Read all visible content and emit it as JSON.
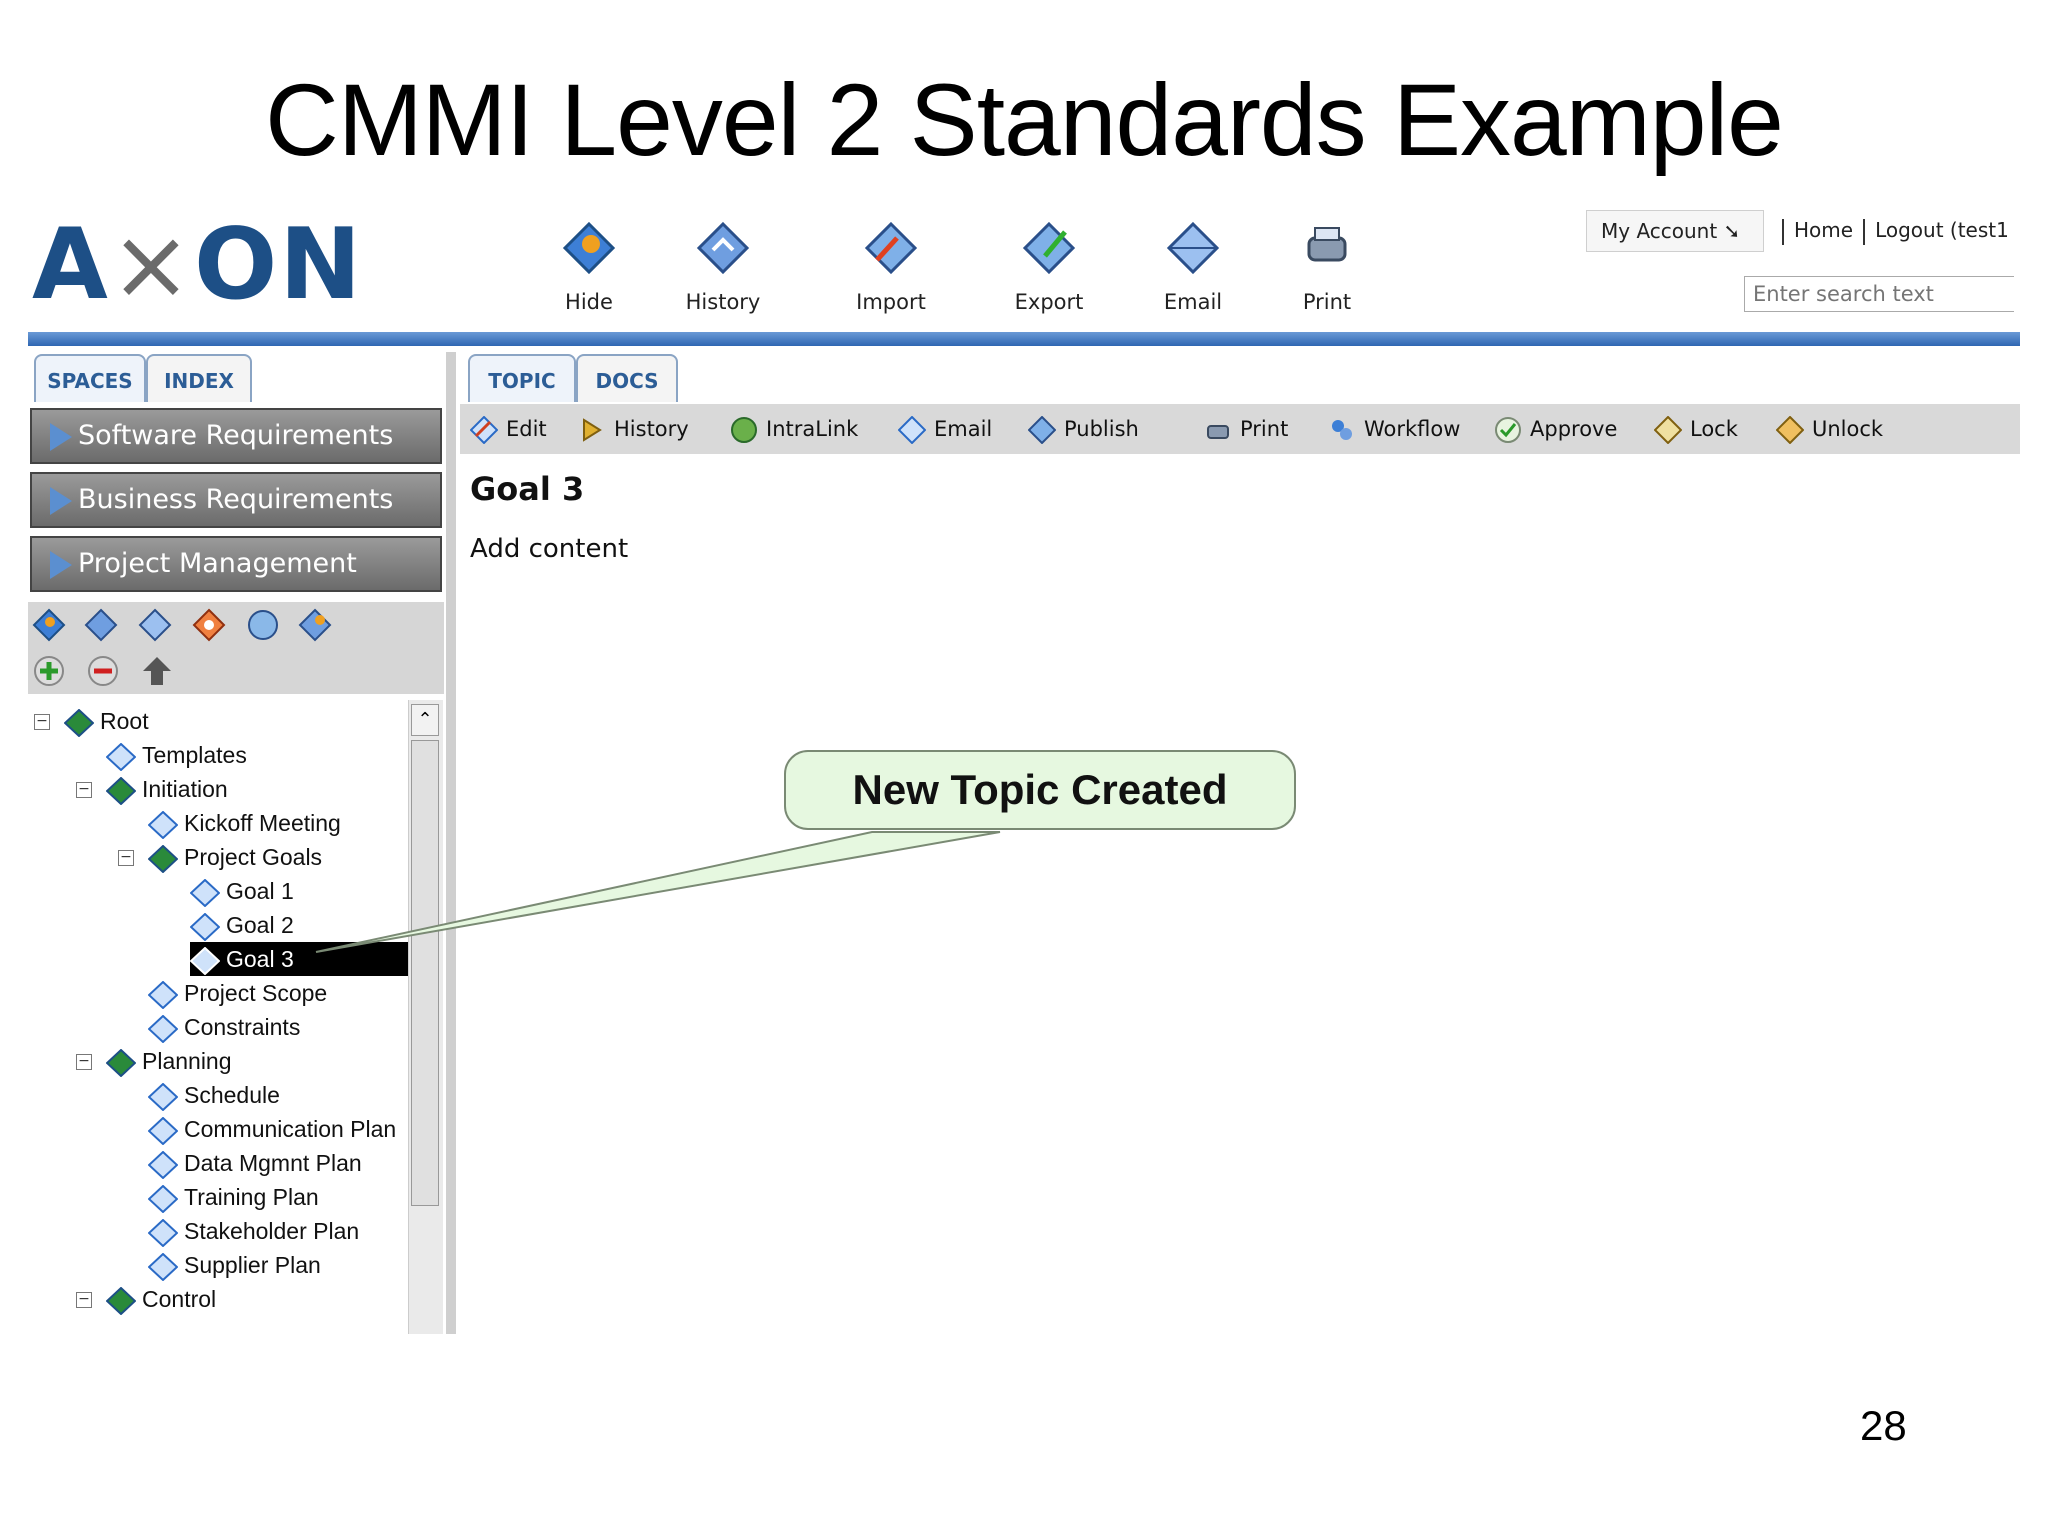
{
  "slide": {
    "title": "CMMI Level 2 Standards Example",
    "page_number": "28"
  },
  "app": {
    "logo": "AXON",
    "toolbar": [
      {
        "label": "Hide",
        "icon": "hide-icon"
      },
      {
        "label": "History",
        "icon": "history-icon"
      },
      {
        "label": "Import",
        "icon": "import-icon"
      },
      {
        "label": "Export",
        "icon": "export-icon"
      },
      {
        "label": "Email",
        "icon": "email-icon"
      },
      {
        "label": "Print",
        "icon": "print-icon"
      }
    ],
    "account": {
      "my_account": "My Account ➘",
      "home": "Home",
      "logout": "Logout (test1"
    },
    "search": {
      "placeholder": "Enter search text"
    },
    "colors": {
      "accent": "#2f66b2",
      "callout_bg": "#e6f8e0",
      "selection": "#000000"
    }
  },
  "left_panel": {
    "tabs": [
      "SPACES",
      "INDEX"
    ],
    "spaces": [
      "Software Requirements",
      "Business Requirements",
      "Project Management"
    ],
    "tree": [
      {
        "label": "Root",
        "level": 0,
        "expander": "−",
        "icon": "folder-icon"
      },
      {
        "label": "Templates",
        "level": 1,
        "icon": "topic-icon"
      },
      {
        "label": "Initiation",
        "level": 1,
        "expander": "−",
        "icon": "folder-icon"
      },
      {
        "label": "Kickoff Meeting",
        "level": 2,
        "icon": "topic-icon"
      },
      {
        "label": "Project Goals",
        "level": 2,
        "expander": "−",
        "icon": "folder-icon"
      },
      {
        "label": "Goal 1",
        "level": 3,
        "icon": "topic-icon"
      },
      {
        "label": "Goal 2",
        "level": 3,
        "icon": "topic-icon"
      },
      {
        "label": "Goal 3",
        "level": 3,
        "icon": "topic-icon",
        "selected": true
      },
      {
        "label": "Project Scope",
        "level": 2,
        "icon": "topic-icon"
      },
      {
        "label": "Constraints",
        "level": 2,
        "icon": "topic-icon"
      },
      {
        "label": "Planning",
        "level": 1,
        "expander": "−",
        "icon": "folder-icon"
      },
      {
        "label": "Schedule",
        "level": 2,
        "icon": "topic-icon"
      },
      {
        "label": "Communication Plan",
        "level": 2,
        "icon": "topic-icon"
      },
      {
        "label": "Data Mgmnt Plan",
        "level": 2,
        "icon": "topic-icon"
      },
      {
        "label": "Training Plan",
        "level": 2,
        "icon": "topic-icon"
      },
      {
        "label": "Stakeholder Plan",
        "level": 2,
        "icon": "topic-icon"
      },
      {
        "label": "Supplier Plan",
        "level": 2,
        "icon": "topic-icon"
      },
      {
        "label": "Control",
        "level": 1,
        "expander": "−",
        "icon": "folder-icon"
      }
    ]
  },
  "right_panel": {
    "tabs": [
      "TOPIC",
      "DOCS"
    ],
    "actions": [
      "Edit",
      "History",
      "IntraLink",
      "Email",
      "Publish",
      "Print",
      "Workflow",
      "Approve",
      "Lock",
      "Unlock"
    ],
    "topic_title": "Goal 3",
    "topic_body": "Add content"
  },
  "callout": {
    "text": "New Topic Created"
  }
}
